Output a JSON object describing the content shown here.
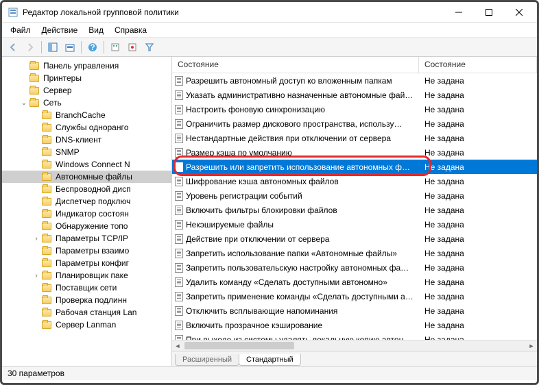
{
  "window": {
    "title": "Редактор локальной групповой политики"
  },
  "menu": {
    "file": "Файл",
    "action": "Действие",
    "view": "Вид",
    "help": "Справка"
  },
  "columns": {
    "c1": "Состояние",
    "c2": "Состояние"
  },
  "tree": [
    {
      "level": 1,
      "exp": "",
      "label": "Панель управления"
    },
    {
      "level": 1,
      "exp": "",
      "label": "Принтеры"
    },
    {
      "level": 1,
      "exp": "",
      "label": "Сервер"
    },
    {
      "level": 1,
      "exp": "v",
      "label": "Сеть"
    },
    {
      "level": 2,
      "exp": "",
      "label": "BranchCache"
    },
    {
      "level": 2,
      "exp": "",
      "label": "Службы однорангo"
    },
    {
      "level": 2,
      "exp": "",
      "label": "DNS-клиент"
    },
    {
      "level": 2,
      "exp": "",
      "label": "SNMP"
    },
    {
      "level": 2,
      "exp": "",
      "label": "Windows Connect N"
    },
    {
      "level": 2,
      "exp": "",
      "label": "Автономные файлы",
      "selected": true
    },
    {
      "level": 2,
      "exp": "",
      "label": "Беспроводной дисп"
    },
    {
      "level": 2,
      "exp": "",
      "label": "Диспетчер подключ"
    },
    {
      "level": 2,
      "exp": "",
      "label": "Индикатор состоян"
    },
    {
      "level": 2,
      "exp": "",
      "label": "Обнаружение топо"
    },
    {
      "level": 2,
      "exp": ">",
      "label": "Параметры TCP/IP"
    },
    {
      "level": 2,
      "exp": "",
      "label": "Параметры взаимо"
    },
    {
      "level": 2,
      "exp": "",
      "label": "Параметры конфиг"
    },
    {
      "level": 2,
      "exp": ">",
      "label": "Планировщик паке"
    },
    {
      "level": 2,
      "exp": "",
      "label": "Поставщик сети"
    },
    {
      "level": 2,
      "exp": "",
      "label": "Проверка подлинн"
    },
    {
      "level": 2,
      "exp": "",
      "label": "Рабочая станция Lan"
    },
    {
      "level": 2,
      "exp": "",
      "label": "Сервер Lanman"
    }
  ],
  "list": [
    {
      "name": "Разрешить автономный доступ ко вложенным папкам",
      "state": "Не задана"
    },
    {
      "name": "Указать административно назначенные автономные фай…",
      "state": "Не задана"
    },
    {
      "name": "Настроить фоновую синхронизацию",
      "state": "Не задана"
    },
    {
      "name": "Ограничить размер дискового пространства, использу…",
      "state": "Не задана"
    },
    {
      "name": "Нестандартные действия при отключении от сервера",
      "state": "Не задана"
    },
    {
      "name": "Размер кэша по умолчанию",
      "state": "Не задана"
    },
    {
      "name": "Разрешить или запретить использование автономных ф…",
      "state": "Не задана",
      "selected": true
    },
    {
      "name": "Шифрование кэша автономных файлов",
      "state": "Не задана"
    },
    {
      "name": "Уровень регистрации событий",
      "state": "Не задана"
    },
    {
      "name": "Включить фильтры блокировки файлов",
      "state": "Не задана"
    },
    {
      "name": "Некэшируемые файлы",
      "state": "Не задана"
    },
    {
      "name": "Действие при отключении от сервера",
      "state": "Не задана"
    },
    {
      "name": "Запретить использование папки «Автономные файлы»",
      "state": "Не задана"
    },
    {
      "name": "Запретить пользовательскую настройку автономных фа…",
      "state": "Не задана"
    },
    {
      "name": "Удалить команду «Сделать доступными автономно»",
      "state": "Не задана"
    },
    {
      "name": "Запретить применение команды «Сделать доступными а…",
      "state": "Не задана"
    },
    {
      "name": "Отключить всплывающие напоминания",
      "state": "Не задана"
    },
    {
      "name": "Включить прозрачное кэширование",
      "state": "Не задана"
    },
    {
      "name": "При выходе из системы удалять локальную копию автон…",
      "state": "Не задана"
    }
  ],
  "tabs": {
    "extended": "Расширенный",
    "standard": "Стандартный"
  },
  "status": "30 параметров"
}
